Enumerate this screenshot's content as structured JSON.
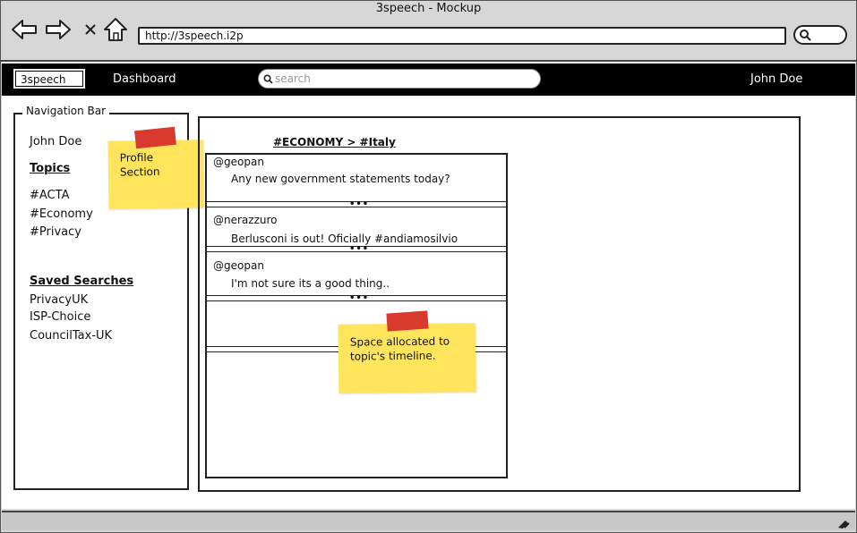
{
  "window": {
    "title": "3speech - Mockup"
  },
  "browser": {
    "url": "http://3speech.i2p",
    "icons": [
      "back-arrow-icon",
      "forward-arrow-icon",
      "close-x-icon",
      "home-icon",
      "search-icon"
    ]
  },
  "app": {
    "logo": "3speech",
    "nav_dashboard": "Dashboard",
    "search_placeholder": "search",
    "user_name": "John Doe"
  },
  "left_panel": {
    "legend": "Navigation Bar",
    "profile_name": "John Doe",
    "topics_heading": "Topics",
    "topics": [
      "#ACTA",
      "#Economy",
      "#Privacy"
    ],
    "saved_heading": "Saved Searches",
    "saved_searches": [
      "PrivacyUK",
      "ISP-Choice",
      "CouncilTax-UK"
    ]
  },
  "main": {
    "breadcrumb": "#ECONOMY > #Italy",
    "posts": [
      {
        "author": "@geopan",
        "text": "Any new government statements today?"
      },
      {
        "author": "@nerazzuro",
        "text": "Berlusconi is out! Oficially #andiamosilvio"
      },
      {
        "author": "@geopan",
        "text": "I'm not sure its a good thing.."
      }
    ],
    "more_indicator": "•••"
  },
  "notes": {
    "profile_note_line1": "Profile",
    "profile_note_line2": "Section",
    "timeline_note_line1": "Space allocated to",
    "timeline_note_line2": "topic's timeline."
  },
  "colors": {
    "app_bar": "#000000",
    "sticky": "#ffe45c",
    "tape": "#d93a2e",
    "chrome": "#d7d7d7"
  }
}
